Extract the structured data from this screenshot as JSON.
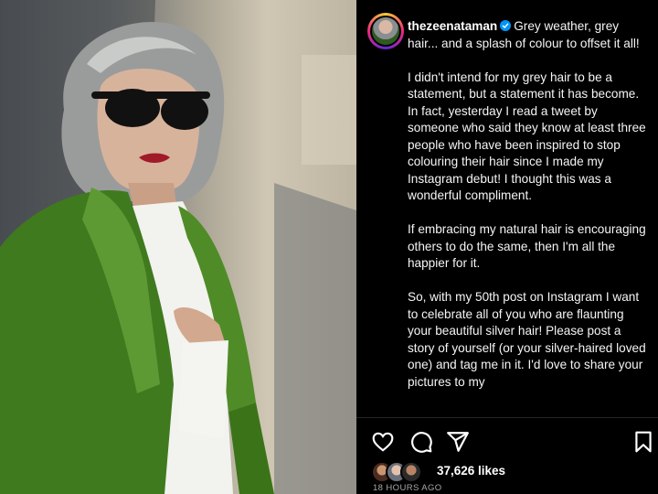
{
  "post": {
    "username": "thezeenataman",
    "caption_first_line": "Grey weather, grey hair... and a splash of colour to offset it all!",
    "paragraphs": [
      "I didn't intend for my grey hair to be a statement, but a statement it has become. In fact, yesterday I read a tweet by someone who said they know at least three people who have been inspired to stop colouring their hair since I made my Instagram debut! I thought this was a wonderful compliment.",
      "If embracing my natural hair is encouraging others to do the same, then I'm all the happier for it.",
      "So, with my 50th post on Instagram I want to celebrate all of you who are flaunting your beautiful silver hair! Please post a story of yourself (or your silver-haired loved one) and tag me in it. I'd love to share your pictures to my"
    ],
    "likes": "37,626 likes",
    "timestamp": "18 HOURS AGO"
  },
  "icons": {
    "like": "heart-icon",
    "comment": "comment-icon",
    "share": "share-icon",
    "save": "bookmark-icon",
    "verified": "verified-badge-icon"
  },
  "colors": {
    "background": "#000000",
    "text": "#f5f5f5",
    "verified": "#0095f6",
    "muted": "#a8a8a8"
  }
}
